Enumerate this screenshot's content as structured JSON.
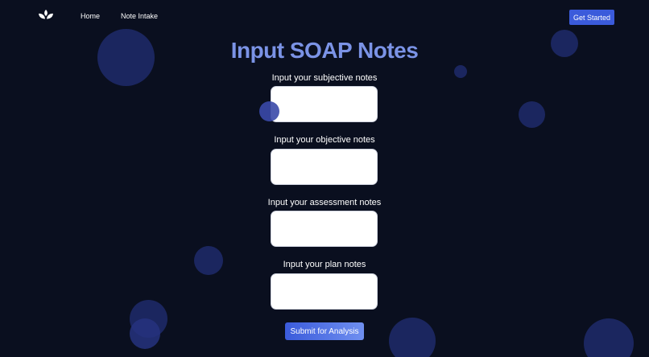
{
  "nav": {
    "logo_icon": "leaf-icon",
    "links": [
      "Home",
      "Note Intake"
    ],
    "cta_label": "Get Started"
  },
  "main": {
    "title": "Input SOAP Notes",
    "fields": [
      {
        "label": "Input your subjective notes",
        "value": ""
      },
      {
        "label": "Input your objective notes",
        "value": ""
      },
      {
        "label": "Input your assessment notes",
        "value": ""
      },
      {
        "label": "Input your plan notes",
        "value": ""
      }
    ],
    "submit_label": "Submit for Analysis"
  },
  "colors": {
    "background": "#0a0f1f",
    "accent": "#3b5bdb",
    "title": "#7b93e6",
    "bubble": "#1f2a6b"
  }
}
